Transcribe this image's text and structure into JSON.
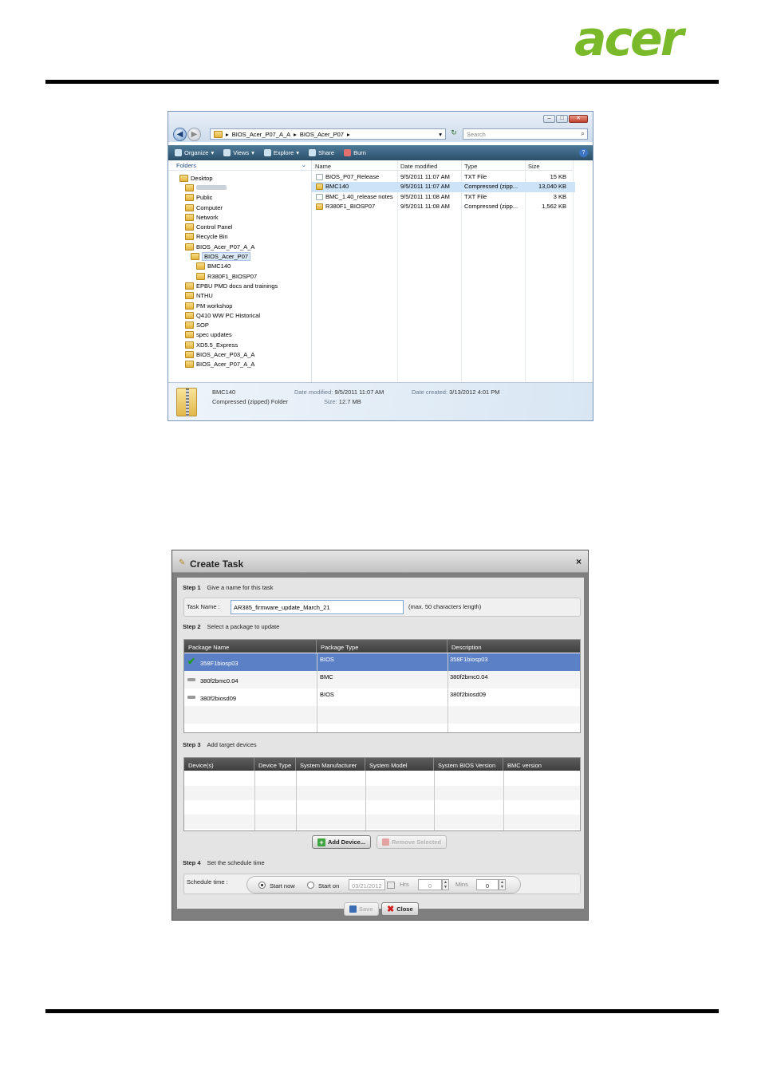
{
  "brand": {
    "logo_text": "acer",
    "color": "#7ab929"
  },
  "explorer": {
    "address": [
      "BIOS_Acer_P07_A_A",
      "BIOS_Acer_P07"
    ],
    "search_placeholder": "Search",
    "toolbar": [
      "Organize",
      "Views",
      "Explore",
      "Share",
      "Burn"
    ],
    "folders_label": "Folders",
    "tree": [
      {
        "label": "Desktop",
        "indent": 0
      },
      {
        "label": "",
        "indent": 1,
        "blurred": true
      },
      {
        "label": "Public",
        "indent": 1
      },
      {
        "label": "Computer",
        "indent": 1
      },
      {
        "label": "Network",
        "indent": 1
      },
      {
        "label": "Control Panel",
        "indent": 1
      },
      {
        "label": "Recycle Bin",
        "indent": 1
      },
      {
        "label": "BIOS_Acer_P07_A_A",
        "indent": 1
      },
      {
        "label": "BIOS_Acer_P07",
        "indent": 2,
        "selected": true
      },
      {
        "label": "BMC140",
        "indent": 3
      },
      {
        "label": "R380F1_BIOSP07",
        "indent": 3
      },
      {
        "label": "EPBU PMD docs and trainings",
        "indent": 1
      },
      {
        "label": "NTHU",
        "indent": 1
      },
      {
        "label": "PM workshop",
        "indent": 1
      },
      {
        "label": "Q410 WW PC Historical",
        "indent": 1
      },
      {
        "label": "SOP",
        "indent": 1
      },
      {
        "label": "spec updates",
        "indent": 1
      },
      {
        "label": "XD5.5_Express",
        "indent": 1
      },
      {
        "label": "BIOS_Acer_P03_A_A",
        "indent": 1
      },
      {
        "label": "BIOS_Acer_P07_A_A",
        "indent": 1
      }
    ],
    "columns": [
      "Name",
      "Date modified",
      "Type",
      "Size"
    ],
    "files": [
      {
        "name": "BIOS_P07_Release",
        "date": "9/5/2011 11:07 AM",
        "type": "TXT File",
        "size": "15 KB",
        "selected": false
      },
      {
        "name": "BMC140",
        "date": "9/5/2011 11:07 AM",
        "type": "Compressed (zipp...",
        "size": "13,040 KB",
        "selected": true
      },
      {
        "name": "BMC_1.40_release notes",
        "date": "9/5/2011 11:08 AM",
        "type": "TXT File",
        "size": "3 KB",
        "selected": false
      },
      {
        "name": "R380F1_BIOSP07",
        "date": "9/5/2011 11:08 AM",
        "type": "Compressed (zipp...",
        "size": "1,562 KB",
        "selected": false
      }
    ],
    "details": {
      "name": "BMC140",
      "kind": "Compressed (zipped) Folder",
      "date_modified_label": "Date modified:",
      "date_modified": "9/5/2011 11:07 AM",
      "date_created_label": "Date created:",
      "date_created": "3/13/2012 4:01 PM",
      "size_label": "Size:",
      "size": "12.7 MB"
    }
  },
  "dialog": {
    "title": "Create Task",
    "close": "×",
    "step1": {
      "num": "Step 1",
      "text": "Give a name for this task"
    },
    "task_name_label": "Task Name :",
    "task_name_value": "AR385_firmware_update_March_21",
    "task_name_hint": "(max. 50 characters length)",
    "step2": {
      "num": "Step 2",
      "text": "Select a package to update"
    },
    "package_columns": [
      "Package Name",
      "Package Type",
      "Description"
    ],
    "packages": [
      {
        "name": "358F1biosp03",
        "type": "BIOS",
        "desc": "358F1biosp03",
        "selected": true
      },
      {
        "name": "380f2bmc0.04",
        "type": "BMC",
        "desc": "380f2bmc0.04",
        "selected": false
      },
      {
        "name": "380f2biosd09",
        "type": "BIOS",
        "desc": "380f2biosd09",
        "selected": false
      }
    ],
    "step3": {
      "num": "Step 3",
      "text": "Add target devices"
    },
    "device_columns": [
      "Device(s)",
      "Device Type",
      "System Manufacturer",
      "System Model",
      "System BIOS Version",
      "BMC version"
    ],
    "add_device": "Add Device...",
    "remove_selected": "Remove Selected",
    "step4": {
      "num": "Step 4",
      "text": "Set the schedule time"
    },
    "schedule_label": "Schedule time :",
    "start_now": "Start now",
    "start_on": "Start on",
    "date_value": "03/21/2012",
    "hrs_label": "Hrs",
    "hrs_value": "0",
    "mins_label": "Mins",
    "mins_value": "0",
    "save": "Save",
    "close_btn": "Close"
  }
}
